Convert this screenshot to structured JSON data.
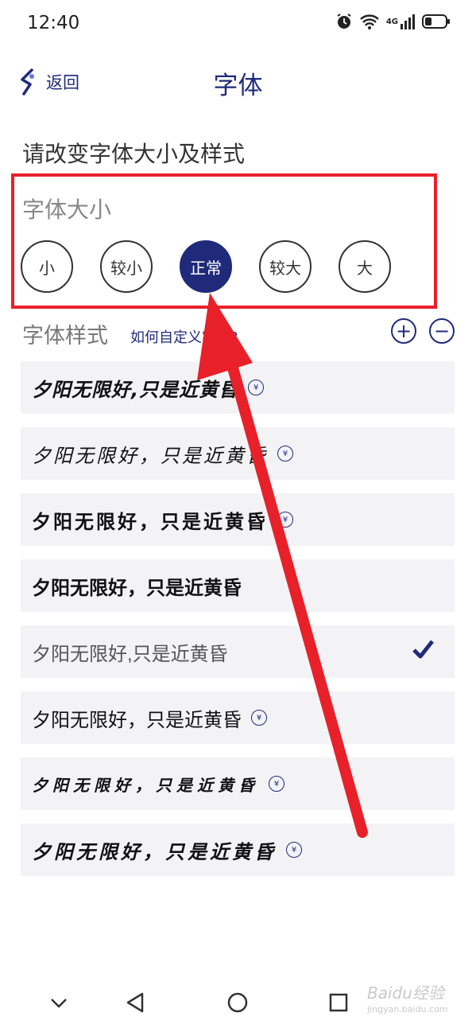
{
  "status": {
    "time": "12:40",
    "network": "4G"
  },
  "header": {
    "back_label": "返回",
    "title": "字体"
  },
  "subtitle": "请改变字体大小及样式",
  "size": {
    "label": "字体大小",
    "options": [
      "小",
      "较小",
      "正常",
      "较大",
      "大"
    ],
    "selected": "正常"
  },
  "style": {
    "label": "字体样式",
    "link": "如何自定义字库?",
    "items": [
      {
        "text": "夕阳无限好,只是近黄昏",
        "paid": true,
        "selected": false
      },
      {
        "text": "夕阳无限好，只是近黄昏",
        "paid": true,
        "selected": false
      },
      {
        "text": "夕阳无限好，只是近黄昏",
        "paid": true,
        "selected": false
      },
      {
        "text": "夕阳无限好，只是近黄昏",
        "paid": false,
        "selected": false
      },
      {
        "text": "夕阳无限好,只是近黄昏",
        "paid": false,
        "selected": true
      },
      {
        "text": "夕阳无限好，只是近黄昏",
        "paid": true,
        "selected": false
      },
      {
        "text": "夕阳无限好，只是近黄昏",
        "paid": true,
        "selected": false
      },
      {
        "text": "夕阳无限好，只是近黄昏",
        "paid": true,
        "selected": false
      }
    ]
  },
  "coin_symbol": "¥",
  "watermark": {
    "main": "Baidu经验",
    "sub": "jingyan.baidu.com"
  },
  "colors": {
    "accent": "#1f2a7a",
    "highlight": "#e8202a",
    "row_bg": "#f3f3f6"
  }
}
